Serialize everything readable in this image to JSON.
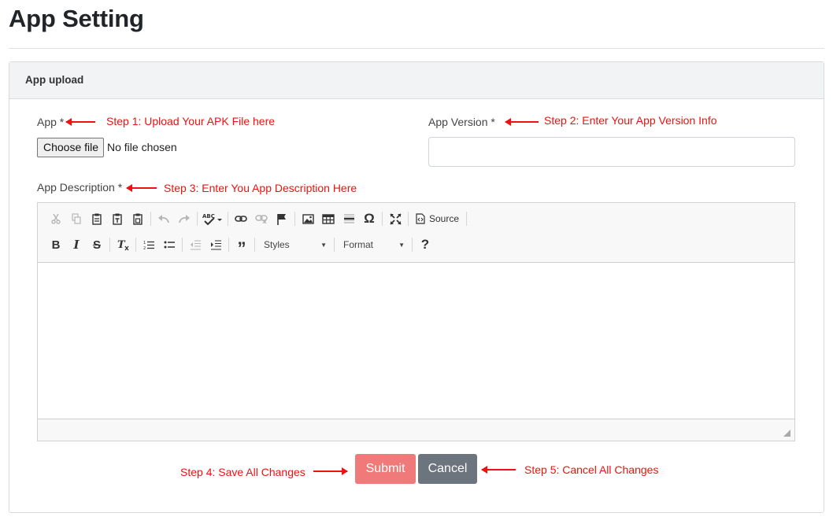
{
  "page": {
    "title": "App Setting"
  },
  "card": {
    "header": "App upload"
  },
  "form": {
    "app_label": "App *",
    "app_version_label": "App Version *",
    "app_description_label": "App Description *",
    "file_button_label": "Choose file",
    "file_status": "No file chosen",
    "app_version_value": ""
  },
  "steps": {
    "step1": "Step 1: Upload Your APK File here",
    "step2": "Step 2: Enter Your App Version Info",
    "step3": "Step 3: Enter You App Description Here",
    "step4": "Step 4: Save All Changes",
    "step5": "Step 5: Cancel All Changes"
  },
  "editor": {
    "source_label": "Source",
    "styles_label": "Styles",
    "format_label": "Format",
    "help_label": "?"
  },
  "buttons": {
    "submit": "Submit",
    "cancel": "Cancel"
  },
  "colors": {
    "annotation": "#ee1111",
    "submit_bg": "#f07a7a",
    "cancel_bg": "#6c757d"
  }
}
